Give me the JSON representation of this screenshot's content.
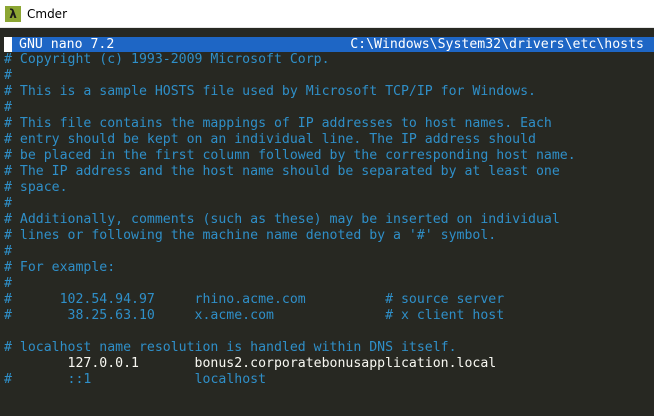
{
  "window": {
    "title": "Cmder",
    "icon": "lambda-icon"
  },
  "nano": {
    "title": "GNU nano 7.2",
    "path": "C:\\Windows\\System32\\drivers\\etc\\hosts"
  },
  "lines": [
    "# Copyright (c) 1993-2009 Microsoft Corp.",
    "#",
    "# This is a sample HOSTS file used by Microsoft TCP/IP for Windows.",
    "#",
    "# This file contains the mappings of IP addresses to host names. Each",
    "# entry should be kept on an individual line. The IP address should",
    "# be placed in the first column followed by the corresponding host name.",
    "# The IP address and the host name should be separated by at least one",
    "# space.",
    "#",
    "# Additionally, comments (such as these) may be inserted on individual",
    "# lines or following the machine name denoted by a '#' symbol.",
    "#",
    "# For example:",
    "#",
    "#      102.54.94.97     rhino.acme.com          # source server",
    "#       38.25.63.10     x.acme.com              # x client host",
    "",
    "# localhost name resolution is handled within DNS itself."
  ],
  "entry_line": "        127.0.0.1       bonus2.corporatebonusapplication.local",
  "last_line": {
    "hash": "#",
    "ip": "       ::1",
    "host": "             localhost"
  },
  "colors": {
    "background": "#272822",
    "comment": "#2f8fc8",
    "text": "#f8f8f2",
    "header_bg": "#1e66c5"
  }
}
